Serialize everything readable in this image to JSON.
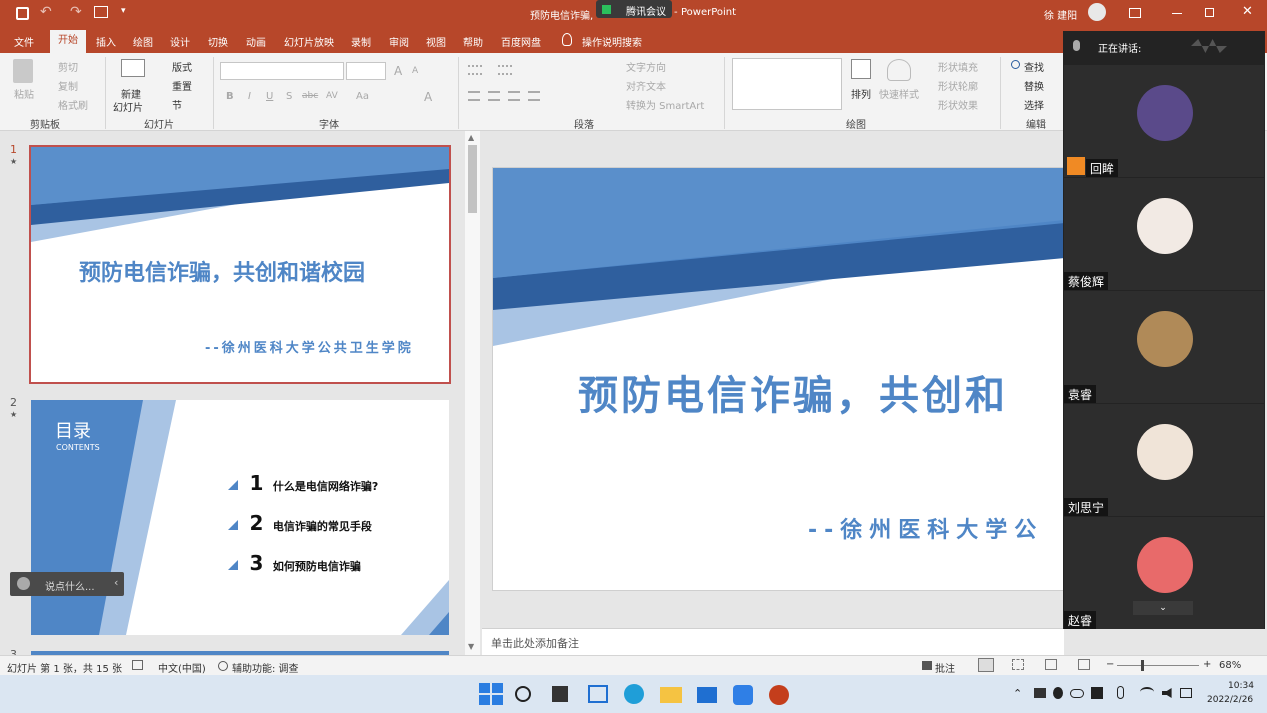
{
  "window": {
    "doc_title": "预防电信诈骗,",
    "app_name": "PowerPoint",
    "separator": "-",
    "meeting_badge": "腾讯会议",
    "user_name": "徐 建阳"
  },
  "tabs": [
    "文件",
    "开始",
    "插入",
    "绘图",
    "设计",
    "切换",
    "动画",
    "幻灯片放映",
    "录制",
    "审阅",
    "视图",
    "帮助",
    "百度网盘"
  ],
  "tell_me": "操作说明搜索",
  "ribbon": {
    "clipboard": {
      "paste": "粘贴",
      "cut": "剪切",
      "copy": "复制",
      "format_painter": "格式刷",
      "label": "剪贴板"
    },
    "slides": {
      "new_line1": "新建",
      "new_line2": "幻灯片",
      "layout": "版式",
      "reset": "重置",
      "section": "节",
      "label": "幻灯片"
    },
    "font": {
      "label": "字体",
      "bold": "B",
      "italic": "I",
      "underline": "U",
      "shadow": "S",
      "strike": "abc",
      "spacing": "AV",
      "case": "Aa",
      "color": "A",
      "grow": "A",
      "shrink": "A"
    },
    "paragraph": {
      "text_dir": "文字方向",
      "align_text": "对齐文本",
      "smartart": "转换为 SmartArt",
      "label": "段落"
    },
    "drawing": {
      "arrange": "排列",
      "quick_styles": "快速样式",
      "fill": "形状填充",
      "outline": "形状轮廓",
      "effects": "形状效果",
      "label": "绘图"
    },
    "editing": {
      "find": "查找",
      "replace": "替换",
      "select": "选择",
      "label": "编辑"
    }
  },
  "thumbnails": [
    {
      "num": "1",
      "star": "★",
      "title": "预防电信诈骗，共创和谐校园",
      "subtitle": "--徐州医科大学公共卫生学院"
    },
    {
      "num": "2",
      "star": "★",
      "heading": "目录",
      "heading_en": "CONTENTS",
      "items": [
        {
          "n": "1",
          "text": "什么是电信网络诈骗?"
        },
        {
          "n": "2",
          "text": "电信诈骗的常见手段"
        },
        {
          "n": "3",
          "text": "如何预防电信诈骗"
        }
      ]
    },
    {
      "num": "3"
    }
  ],
  "chat_input": "说点什么...",
  "main_slide": {
    "title": "预防电信诈骗，共创和",
    "subtitle": "--徐州医科大学公"
  },
  "notes_placeholder": "单击此处添加备注",
  "status": {
    "slide_info": "幻灯片 第 1 张，共 15 张",
    "language": "中文(中国)",
    "accessibility": "辅助功能: 调查",
    "comments": "批注",
    "zoom": "68%",
    "minus": "−",
    "plus": "+"
  },
  "meeting": {
    "speaking_label": "正在讲话:",
    "participants": [
      {
        "name": "回眸",
        "color": "#5a4a8a"
      },
      {
        "name": "蔡俊辉",
        "color": "#f2eae4"
      },
      {
        "name": "袁睿",
        "color": "#b08a58"
      },
      {
        "name": "刘思宁",
        "color": "#f0e4d8"
      },
      {
        "name": "赵睿",
        "color": "#e86a6a"
      }
    ]
  },
  "clock": {
    "time": "10:34",
    "date": "2022/2/26"
  },
  "colors": {
    "accent": "#b7472a",
    "slide_blue": "#4f86c6",
    "slide_dark": "#2f5f9e",
    "slide_light": "#a9c4e4"
  }
}
